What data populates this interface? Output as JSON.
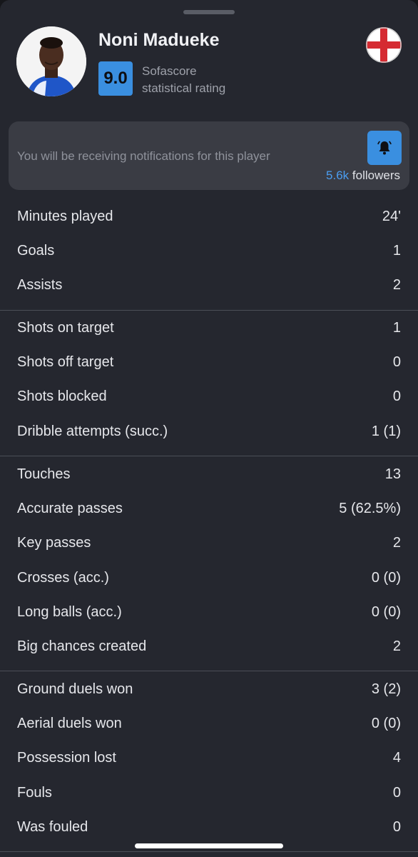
{
  "player": {
    "name": "Noni Madueke",
    "rating": "9.0",
    "rating_caption_line1": "Sofascore",
    "rating_caption_line2": "statistical rating",
    "nationality_flag": "england-flag-icon"
  },
  "notifications": {
    "text": "You will be receiving notifications for this player",
    "followers_count": "5.6k",
    "followers_label": " followers"
  },
  "colors": {
    "background": "#25272f",
    "card": "#3a3c44",
    "accent": "#3a8fe0"
  },
  "stats_groups": [
    [
      {
        "label": "Minutes played",
        "value": "24'"
      },
      {
        "label": "Goals",
        "value": "1"
      },
      {
        "label": "Assists",
        "value": "2"
      }
    ],
    [
      {
        "label": "Shots on target",
        "value": "1"
      },
      {
        "label": "Shots off target",
        "value": "0"
      },
      {
        "label": "Shots blocked",
        "value": "0"
      },
      {
        "label": "Dribble attempts (succ.)",
        "value": "1 (1)"
      }
    ],
    [
      {
        "label": "Touches",
        "value": "13"
      },
      {
        "label": "Accurate passes",
        "value": "5 (62.5%)"
      },
      {
        "label": "Key passes",
        "value": "2"
      },
      {
        "label": "Crosses (acc.)",
        "value": "0 (0)"
      },
      {
        "label": "Long balls (acc.)",
        "value": "0 (0)"
      },
      {
        "label": "Big chances created",
        "value": "2"
      }
    ],
    [
      {
        "label": "Ground duels won",
        "value": "3 (2)"
      },
      {
        "label": "Aerial duels won",
        "value": "0 (0)"
      },
      {
        "label": "Possession lost",
        "value": "4"
      },
      {
        "label": "Fouls",
        "value": "0"
      },
      {
        "label": "Was fouled",
        "value": "0"
      }
    ]
  ]
}
